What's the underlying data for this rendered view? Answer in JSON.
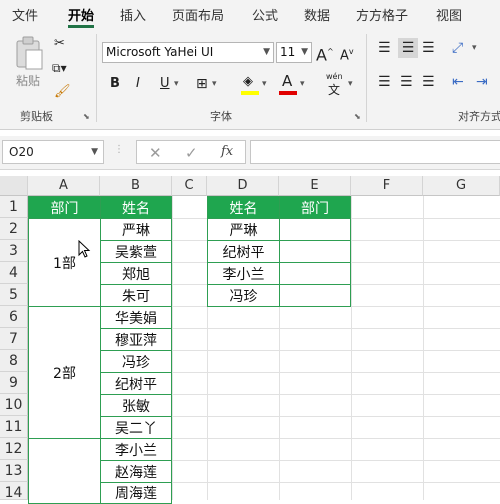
{
  "ribbon_tabs": [
    "文件",
    "开始",
    "插入",
    "页面布局",
    "公式",
    "数据",
    "方方格子",
    "视图"
  ],
  "clipboard": {
    "paste_label": "粘贴",
    "group_label": "剪贴板"
  },
  "font": {
    "name": "Microsoft YaHei UI",
    "size": "11",
    "group_label": "字体",
    "bold": "B",
    "italic": "I",
    "underline": "U",
    "grow": "A",
    "shrink": "A",
    "font_color": "A",
    "wen": "wén",
    "wen_char": "文"
  },
  "alignment": {
    "group_label": "对齐方式"
  },
  "formula_bar": {
    "name_box": "O20",
    "cancel": "✕",
    "enter": "✓",
    "fx": "fx",
    "content": ""
  },
  "columns": [
    "A",
    "B",
    "C",
    "D",
    "E",
    "F",
    "G"
  ],
  "rows": [
    "1",
    "2",
    "3",
    "4",
    "5",
    "6",
    "7",
    "8",
    "9",
    "10",
    "11",
    "12",
    "13",
    "14"
  ],
  "table1": {
    "headers": [
      "部门",
      "姓名"
    ],
    "groups": [
      {
        "dept": "1部",
        "names": [
          "严琳",
          "吴紫萱",
          "郑旭",
          "朱可"
        ]
      },
      {
        "dept": "2部",
        "names": [
          "华美娟",
          "穆亚萍",
          "冯珍",
          "纪树平",
          "张敏",
          "吴二丫"
        ]
      },
      {
        "dept": "",
        "names": [
          "李小兰",
          "赵海莲",
          "周海莲"
        ]
      }
    ]
  },
  "table2": {
    "headers": [
      "姓名",
      "部门"
    ],
    "rows": [
      [
        "严琳",
        ""
      ],
      [
        "纪树平",
        ""
      ],
      [
        "李小兰",
        ""
      ],
      [
        "冯珍",
        ""
      ]
    ]
  },
  "colors": {
    "accent": "#217346",
    "header_fill": "#1fa64f",
    "border": "#2e9e52",
    "highlight_yellow": "#ffff00",
    "font_red": "#e00000"
  }
}
